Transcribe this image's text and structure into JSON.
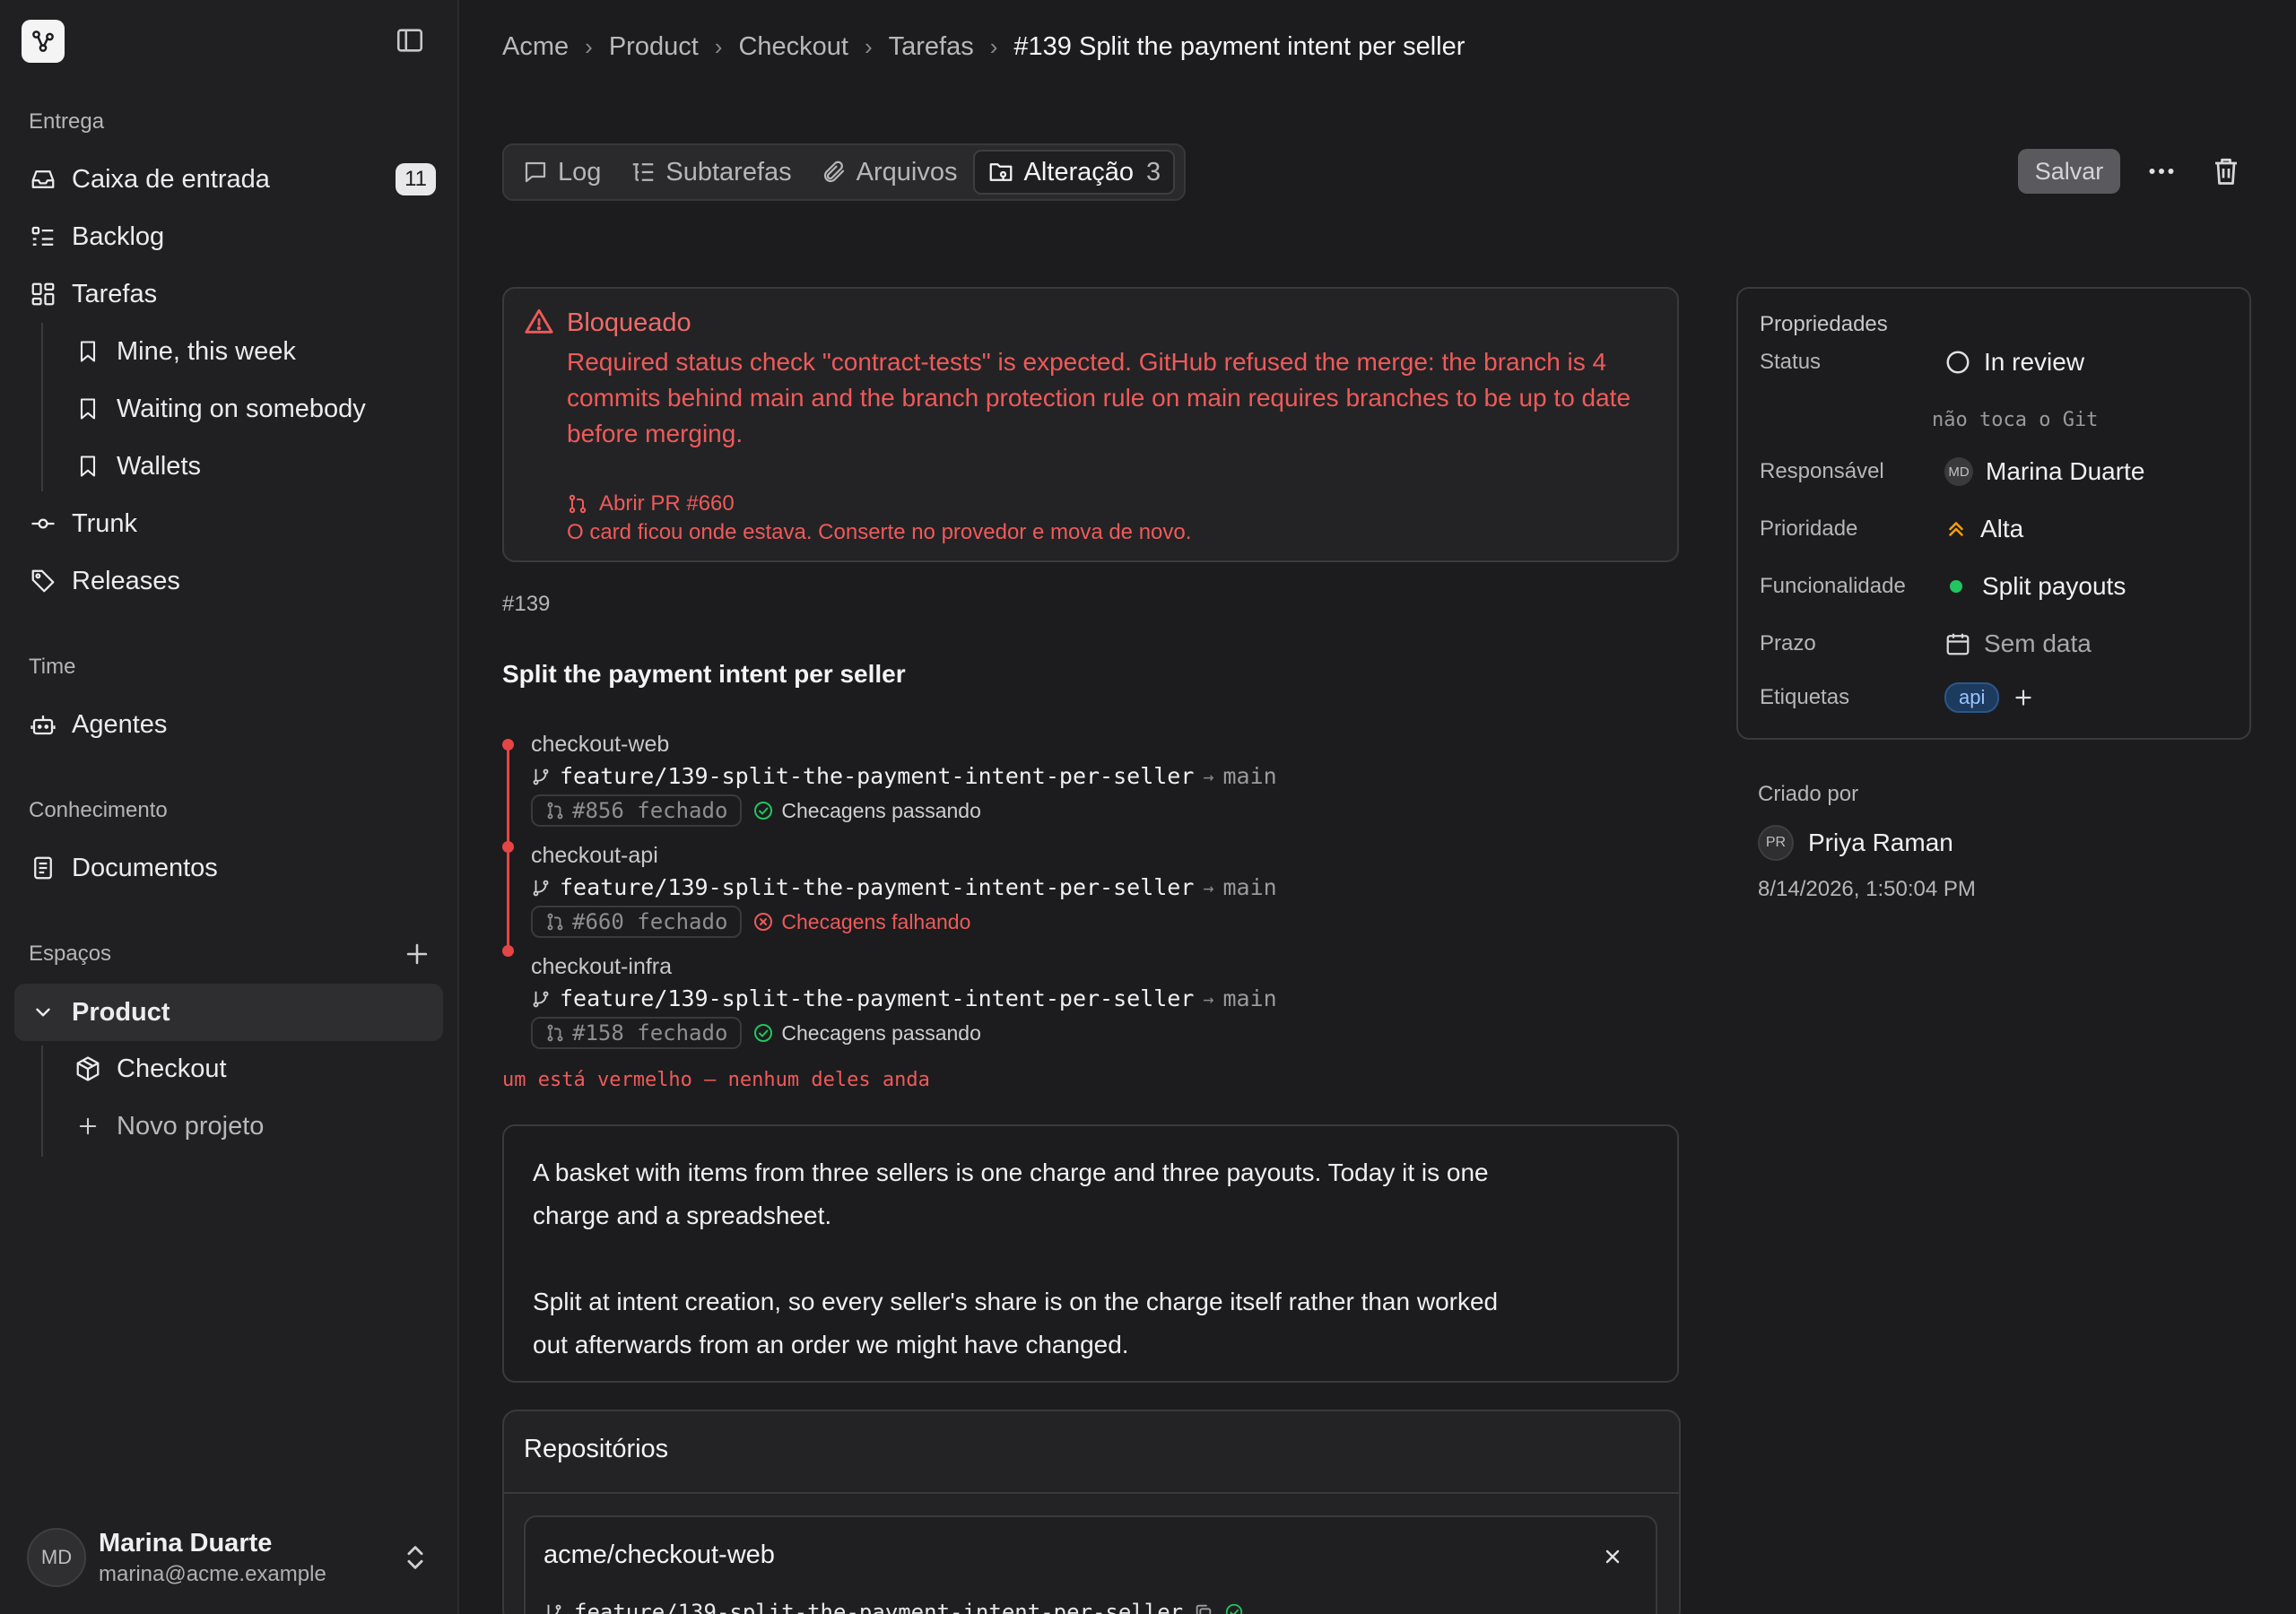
{
  "sidebar": {
    "sections": {
      "delivery": "Entrega",
      "team": "Time",
      "knowledge": "Conhecimento",
      "spaces": "Espaços"
    },
    "inbox": {
      "label": "Caixa de entrada",
      "badge": "11"
    },
    "backlog": "Backlog",
    "tasks": "Tarefas",
    "views": [
      "Mine, this week",
      "Waiting on somebody",
      "Wallets"
    ],
    "trunk": "Trunk",
    "releases": "Releases",
    "agents": "Agentes",
    "documents": "Documentos",
    "space": "Product",
    "project": "Checkout",
    "new_project": "Novo projeto",
    "user": {
      "initials": "MD",
      "name": "Marina Duarte",
      "email": "marina@acme.example"
    }
  },
  "breadcrumb": [
    "Acme",
    "Product",
    "Checkout",
    "Tarefas",
    "#139 Split the payment intent per seller"
  ],
  "tabs": {
    "log": "Log",
    "subtasks": "Subtarefas",
    "files": "Arquivos",
    "change": "Alteração",
    "change_count": "3"
  },
  "actions": {
    "save": "Salvar"
  },
  "alert": {
    "title": "Bloqueado",
    "message": "Required status check \"contract-tests\" is expected. GitHub refused the merge: the branch is 4 commits behind main and the branch protection rule on main requires branches to be up to date before merging.",
    "link": "Abrir PR #660",
    "note": "O card ficou onde estava. Conserte no provedor e mova de novo."
  },
  "task": {
    "number": "#139",
    "title": "Split the payment intent per seller",
    "repos": [
      {
        "name": "checkout-web",
        "branch": "feature/139-split-the-payment-intent-per-seller",
        "arrow": "→",
        "target": "main",
        "pr": "#856 fechado",
        "check": "Checagens passando",
        "status": "ok"
      },
      {
        "name": "checkout-api",
        "branch": "feature/139-split-the-payment-intent-per-seller",
        "arrow": "→",
        "target": "main",
        "pr": "#660 fechado",
        "check": "Checagens falhando",
        "status": "fail"
      },
      {
        "name": "checkout-infra",
        "branch": "feature/139-split-the-payment-intent-per-seller",
        "arrow": "→",
        "target": "main",
        "pr": "#158 fechado",
        "check": "Checagens passando",
        "status": "ok"
      }
    ],
    "red_note": "um está vermelho — nenhum deles anda",
    "description": [
      "A basket with items from three sellers is one charge and three payouts. Today it is one charge and a spreadsheet.",
      "Split at intent creation, so every seller's share is on the charge itself rather than worked out afterwards from an order we might have changed."
    ]
  },
  "repositories": {
    "title": "Repositórios",
    "card": {
      "name": "acme/checkout-web",
      "branch": "feature/139-split-the-payment-intent-per-seller"
    }
  },
  "properties": {
    "title": "Propriedades",
    "status": {
      "label": "Status",
      "value": "In review",
      "hint": "não toca o Git"
    },
    "assignee": {
      "label": "Responsável",
      "initials": "MD",
      "value": "Marina Duarte"
    },
    "priority": {
      "label": "Prioridade",
      "value": "Alta"
    },
    "feature": {
      "label": "Funcionalidade",
      "value": "Split payouts"
    },
    "due": {
      "label": "Prazo",
      "value": "Sem data"
    },
    "tags": {
      "label": "Etiquetas",
      "items": [
        "api"
      ]
    }
  },
  "created": {
    "label": "Criado por",
    "initials": "PR",
    "name": "Priya Raman",
    "date": "8/14/2026, 1:50:04 PM"
  },
  "colors": {
    "danger": "#ef5a5a",
    "success": "#22c55e",
    "priority": "#f59e0b",
    "tag": "#9cc5ff"
  }
}
